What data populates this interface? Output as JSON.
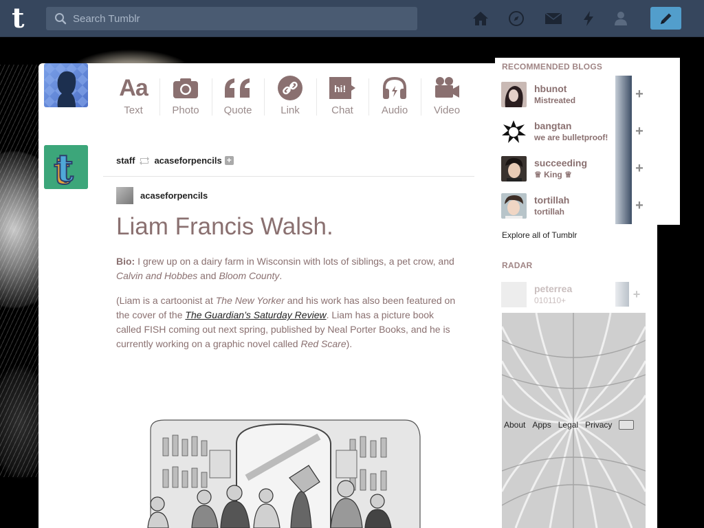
{
  "topbar": {
    "logo": "t",
    "search_placeholder": "Search Tumblr",
    "icons": [
      "home-icon",
      "explore-icon",
      "inbox-icon",
      "activity-icon",
      "account-icon",
      "compose-icon"
    ],
    "colors": {
      "bar": "#36465d",
      "compose": "#529ecc"
    }
  },
  "post_types": [
    {
      "label": "Text",
      "icon": "text-icon"
    },
    {
      "label": "Photo",
      "icon": "camera-icon"
    },
    {
      "label": "Quote",
      "icon": "quote-icon"
    },
    {
      "label": "Link",
      "icon": "link-icon"
    },
    {
      "label": "Chat",
      "icon": "chat-icon"
    },
    {
      "label": "Audio",
      "icon": "headphones-icon"
    },
    {
      "label": "Video",
      "icon": "video-icon"
    }
  ],
  "post": {
    "reblogger": "staff",
    "source": "acaseforpencils",
    "origin_blog": "acaseforpencils",
    "title": "Liam Francis Walsh.",
    "bio_label": "Bio:",
    "bio_text_1": " I grew up on a dairy farm in Wisconsin with lots of siblings, a pet crow, and ",
    "bio_em_1": "Calvin and Hobbes",
    "bio_text_2": " and ",
    "bio_em_2": "Bloom County",
    "bio_text_3": ".",
    "p2_1": "(Liam is a cartoonist at ",
    "p2_em_1": "The New Yorker",
    "p2_2": " and his work has also been featured on the cover of the ",
    "p2_link": "The Guardian’s Saturday Review",
    "p2_3": ". Liam has a picture book called FISH coming out next spring, published by Neal Porter Books, and he is currently working on a graphic novel called ",
    "p2_em_2": "Red Scare",
    "p2_4": ")."
  },
  "sidebar": {
    "recommended_heading": "RECOMMENDED BLOGS",
    "recommended": [
      {
        "name": "hbunot",
        "desc": "Mistreated"
      },
      {
        "name": "bangtan",
        "desc": "we are bulletproof!"
      },
      {
        "name": "succeeding",
        "desc": "♕ King ♕"
      },
      {
        "name": "tortillah",
        "desc": "tortillah"
      }
    ],
    "explore_link": "Explore all of Tumblr",
    "radar_heading": "RADAR",
    "radar": {
      "name": "peterrea",
      "desc": "010110+"
    },
    "footer": [
      "About",
      "Apps",
      "Legal",
      "Privacy"
    ]
  }
}
